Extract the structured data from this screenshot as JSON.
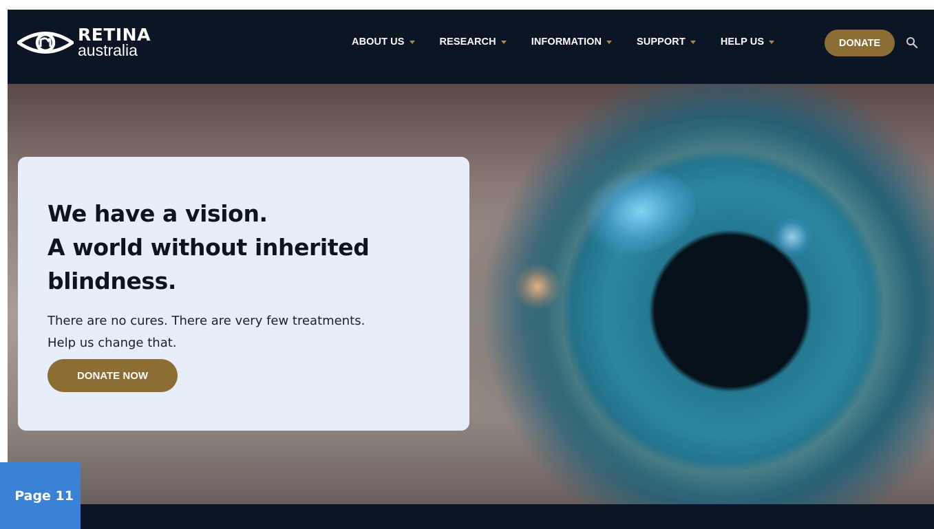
{
  "brand": {
    "name_top": "RETINA",
    "name_bottom": "australia",
    "icon": "eye-logo-icon"
  },
  "nav": {
    "items": [
      {
        "label": "ABOUT US"
      },
      {
        "label": "RESEARCH"
      },
      {
        "label": "INFORMATION"
      },
      {
        "label": "SUPPORT"
      },
      {
        "label": "HELP US"
      }
    ],
    "donate_label": "DONATE",
    "search_icon": "search-icon"
  },
  "hero": {
    "headline": [
      "We have a vision.",
      "A world without inherited",
      "blindness."
    ],
    "subtext": [
      "There are no cures. There are very few treatments.",
      "Help us change that."
    ],
    "cta_label": "DONATE NOW"
  },
  "page_tag": {
    "label": "Page 11"
  },
  "colors": {
    "header_bg": "#0b1526",
    "accent_gold": "#8c6e35",
    "card_bg": "#e8eef9",
    "page_tag_bg": "#3b82d6"
  }
}
